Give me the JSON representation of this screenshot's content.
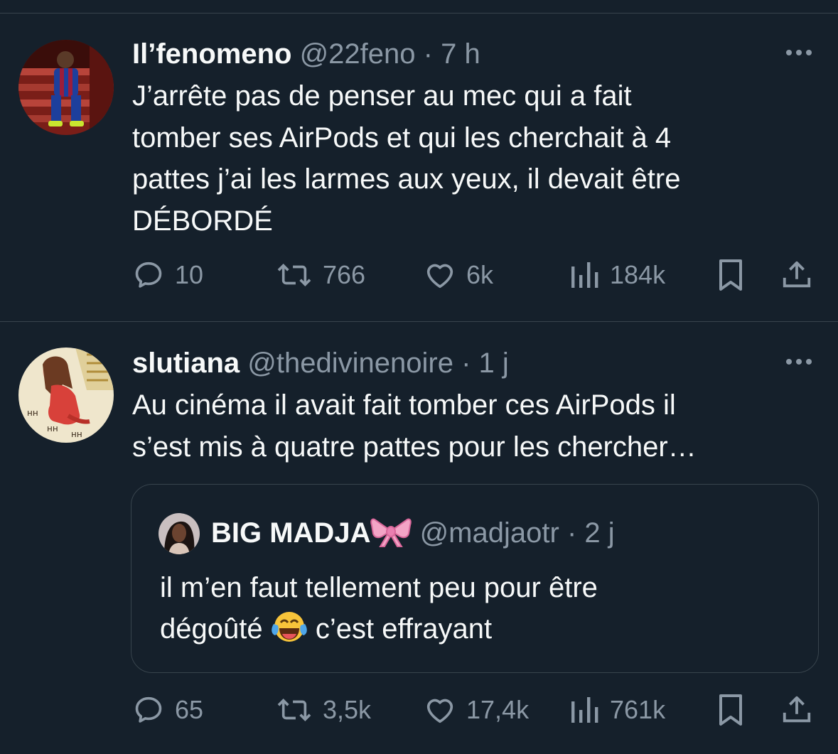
{
  "tweets": [
    {
      "name": "Il’fenomeno",
      "handle": "@22feno",
      "separator": "·",
      "time": "7 h",
      "lines": [
        "J’arrête pas de penser au mec qui a fait",
        "tomber ses AirPods et qui les cherchait à 4",
        "pattes j’ai les larmes aux yeux, il devait être",
        "DÉBORDÉ"
      ],
      "stats": {
        "replies": "10",
        "reposts": "766",
        "likes": "6k",
        "views": "184k"
      }
    },
    {
      "name": "slutiana",
      "handle": "@thedivinenoire",
      "separator": "·",
      "time": "1 j",
      "lines": [
        "Au cinéma il avait fait tomber ces AirPods il",
        "s’est mis à quatre pattes pour les chercher…"
      ],
      "quote": {
        "name": "BIG MADJA",
        "handle": "@madjaotr",
        "separator": "·",
        "time": "2 j",
        "line1": "il m’en faut tellement peu pour être",
        "line2_before": "dégoûté",
        "line2_after": "c’est effrayant"
      },
      "stats": {
        "replies": "65",
        "reposts": "3,5k",
        "likes": "17,4k",
        "views": "761k"
      }
    }
  ],
  "icons": {
    "reply": "comment-bubble-icon",
    "repost": "repost-arrows-icon",
    "like": "heart-outline-icon",
    "views": "bar-chart-icon",
    "bookmark": "bookmark-icon",
    "share": "share-upload-icon",
    "more": "more-dots-icon",
    "bow": "pink-ribbon-bow-icon",
    "laugh": "face-with-tears-of-joy-icon"
  },
  "colors": {
    "background": "#15202b",
    "text": "#f7f9f9",
    "secondary": "#8b98a5",
    "divider": "#38444d"
  }
}
